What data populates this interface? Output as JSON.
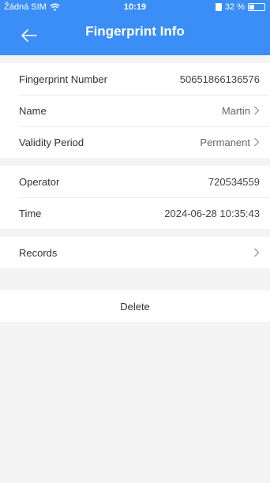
{
  "status_bar": {
    "carrier": "Žádná SIM",
    "time": "10:19",
    "battery": "32 %"
  },
  "navbar": {
    "title": "Fingerprint Info"
  },
  "info_group": {
    "fingerprint_number_label": "Fingerprint Number",
    "fingerprint_number_value": "50651866136576",
    "name_label": "Name",
    "name_value": "Martin",
    "validity_label": "Validity Period",
    "validity_value": "Permanent"
  },
  "operator_group": {
    "operator_label": "Operator",
    "operator_value": "720534559",
    "time_label": "Time",
    "time_value": "2024-06-28 10:35:43"
  },
  "records_group": {
    "records_label": "Records"
  },
  "actions": {
    "delete_label": "Delete"
  },
  "colors": {
    "accent": "#3a8ef6"
  }
}
